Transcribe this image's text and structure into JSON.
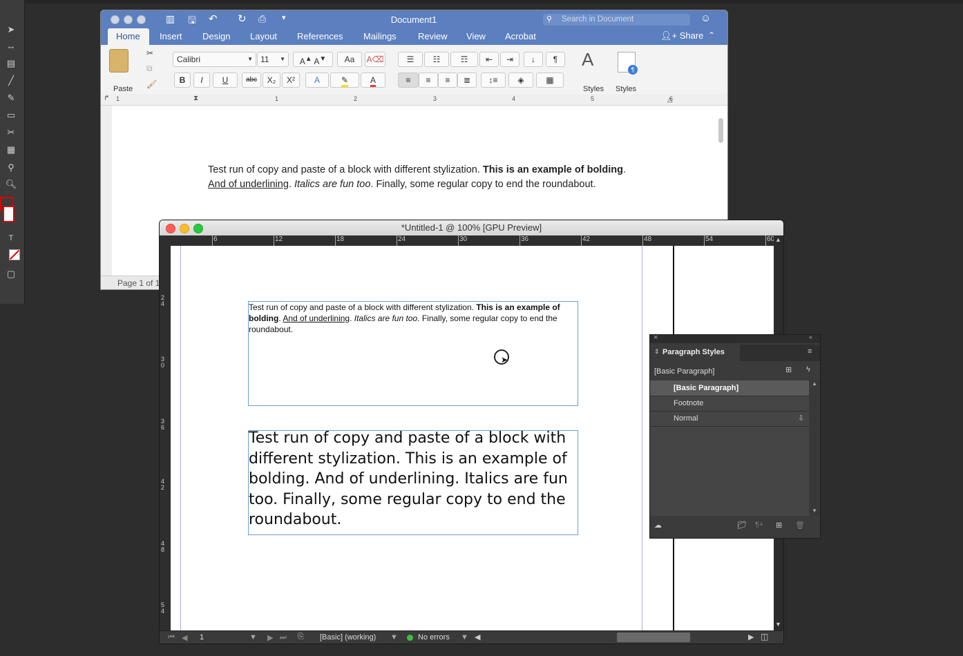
{
  "word": {
    "title": "Document1",
    "search_placeholder": "Search in Document",
    "tabs": [
      "Home",
      "Insert",
      "Design",
      "Layout",
      "References",
      "Mailings",
      "Review",
      "View",
      "Acrobat"
    ],
    "share_label": "Share",
    "paste_label": "Paste",
    "font_name": "Calibri",
    "font_size": "11",
    "styles_label": "Styles",
    "styles_pane_label": "Styles\nPane",
    "ruler_numbers": [
      "1",
      "1",
      "2",
      "3",
      "4",
      "5",
      "6"
    ],
    "status_page": "Page 1 of 1",
    "doc_text": {
      "line1_normal": "Test run of copy and paste of a block with different stylization. ",
      "line1_bold": "This is an example of bolding",
      "line1_end": ".",
      "line2_underline": "And of underlining",
      "line2_sep": ". ",
      "line2_italic": "Italics are fun too",
      "line2_end": ". Finally, some regular copy to end the roundabout."
    }
  },
  "indesign": {
    "title": "*Untitled-1 @ 100% [GPU Preview]",
    "hruler_ticks": [
      "6",
      "12",
      "18",
      "24",
      "30",
      "36",
      "42",
      "48",
      "54",
      "60"
    ],
    "vruler_ticks": [
      "2\n4",
      "3\n0",
      "3\n6",
      "4\n2",
      "4\n8",
      "5\n4"
    ],
    "frame1": {
      "normal1": "Test run of copy and paste of a block with different stylization. ",
      "bold1": "This is an example of bolding",
      "sep1": ". ",
      "underline": "And of underlining",
      "sep2": ". ",
      "italic": "Italics are fun too",
      "end": ". Finally, some regular copy to end the roundabout."
    },
    "frame2_text": "Test run of copy and paste of a block with different stylization. This is an example of bolding. And of underlining. Italics are fun too. Finally, some regular copy to end the roundabout.",
    "status": {
      "page": "1",
      "preflight_profile": "[Basic] (working)",
      "errors": "No errors"
    }
  },
  "paragraph_styles": {
    "title": "Paragraph Styles",
    "current": "[Basic Paragraph]",
    "items": [
      "[Basic Paragraph]",
      "Footnote",
      "Normal"
    ]
  }
}
